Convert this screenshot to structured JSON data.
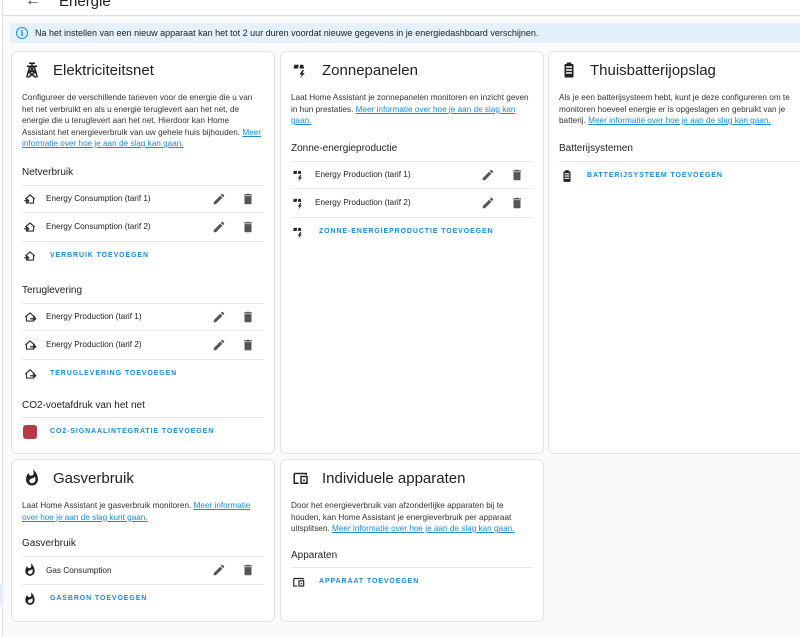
{
  "header": {
    "back_icon": "arrow-left-icon",
    "title": "Energie"
  },
  "alert": {
    "icon": "info-circle-icon",
    "text": "Na het instellen van een nieuw apparaat kan het tot 2 uur duren voordat nieuwe gegevens in je energiedashboard verschijnen."
  },
  "colors": {
    "accent": "#1a8ad6",
    "alert_bg": "#e4f1fb",
    "co2_icon": "#b3394b"
  },
  "grid": {
    "icon": "transmission-tower-icon",
    "title": "Elektriciteitsnet",
    "desc": "Configureer de verschillende tarieven voor de energie die u van het net verbruikt en als u energie teruglevert aan het net, de energie die u teruglevert aan het net. Hierdoor kan Home Assistant het energieverbruik van uw gehele huis bijhouden.",
    "link": "Meer informatie over hoe je aan de slag kan gaan.",
    "consumption_title": "Netverbruik",
    "consumption_items": [
      "Energy Consumption (tarif 1)",
      "Energy Consumption (tarif 2)"
    ],
    "consumption_add": "VERBRUIK TOEVOEGEN",
    "return_title": "Teruglevering",
    "return_items": [
      "Energy Production (tarif 1)",
      "Energy Production (tarif 2)"
    ],
    "return_add": "TERUGLEVERING TOEVOEGEN",
    "co2_title": "CO2-voetafdruk van het net",
    "co2_add": "CO2-SIGNAALINTEGRATIE TOEVOEGEN"
  },
  "solar": {
    "icon": "solar-power-icon",
    "title": "Zonnepanelen",
    "desc": "Laat Home Assistant je zonnepanelen monitoren en inzicht geven in hun prestaties.",
    "link": "Meer informatie over hoe je aan de slag kan gaan.",
    "section_title": "Zonne-energieproductie",
    "items": [
      "Energy Production (tarif 1)",
      "Energy Production (tarif 2)"
    ],
    "add": "ZONNE-ENERGIEPRODUCTIE TOEVOEGEN"
  },
  "battery": {
    "icon": "home-battery-icon",
    "title": "Thuisbatterijopslag",
    "desc": "Als je een batterijsysteem hebt, kunt je deze configureren om te monitoren hoeveel energie er is opgeslagen en gebruikt van je batterij.",
    "link": "Meer informatie over hoe je aan de slag kan gaan.",
    "section_title": "Batterijsystemen",
    "add": "BATTERIJSYSTEEM TOEVOEGEN"
  },
  "gas": {
    "icon": "fire-icon",
    "title": "Gasverbruik",
    "desc": "Laat Home Assistant je gasverbruik monitoren.",
    "link": "Meer informatie over hoe je aan de slag kunt gaan.",
    "section_title": "Gasverbruik",
    "items": [
      "Gas Consumption"
    ],
    "add": "GASBRON TOEVOEGEN"
  },
  "devices": {
    "icon": "devices-icon",
    "title": "Individuele apparaten",
    "desc": "Door het energieverbruik van afzonderlijke apparaten bij te houden, kan Home Assistant je energieverbruik per apparaat uitsplitsen.",
    "link": "Meer informatie over hoe je aan de slag kan gaan.",
    "section_title": "Apparaten",
    "add": "APPARAAT TOEVOEGEN"
  }
}
